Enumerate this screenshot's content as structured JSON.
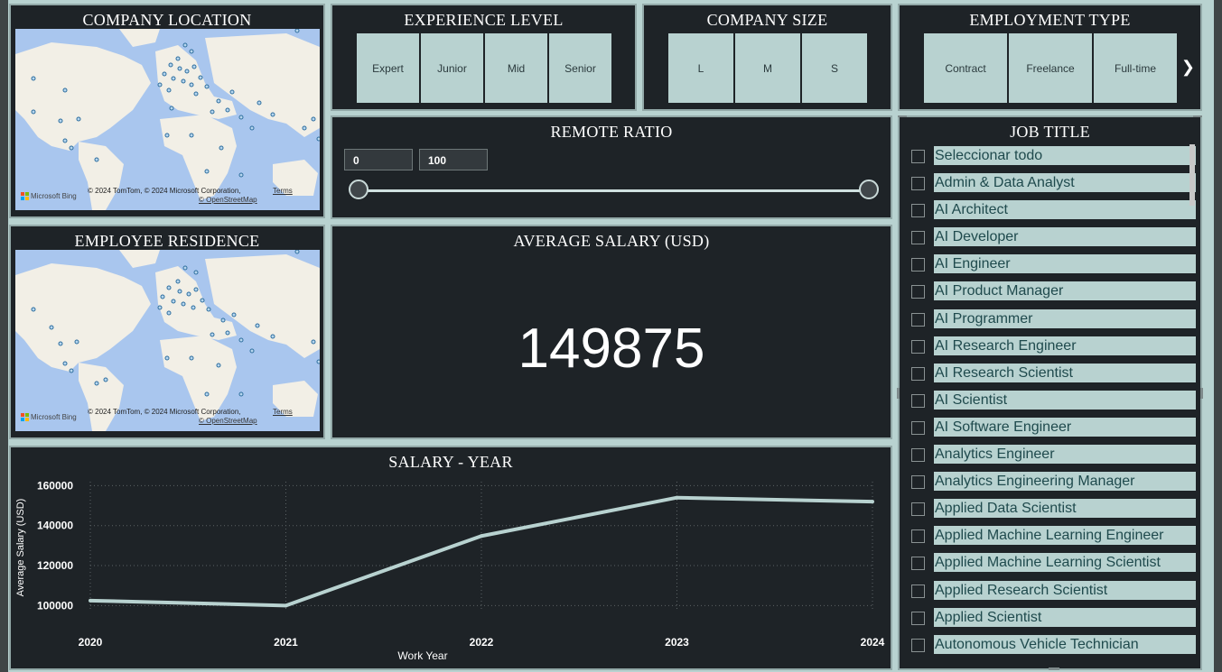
{
  "company_location": {
    "title": "COMPANY LOCATION",
    "attribution": "© 2024 TomTom, © 2024 Microsoft Corporation,",
    "terms": "Terms",
    "osm": "© OpenStreetMap",
    "bing": "Microsoft Bing"
  },
  "employee_residence": {
    "title": "EMPLOYEE RESIDENCE",
    "attribution": "© 2024 TomTom, © 2024 Microsoft Corporation,",
    "terms": "Terms",
    "osm": "© OpenStreetMap",
    "bing": "Microsoft Bing"
  },
  "experience_level": {
    "title": "EXPERIENCE LEVEL",
    "options": [
      "Expert",
      "Junior",
      "Mid",
      "Senior"
    ]
  },
  "company_size": {
    "title": "COMPANY SIZE",
    "options": [
      "L",
      "M",
      "S"
    ]
  },
  "employment_type": {
    "title": "EMPLOYMENT TYPE",
    "options": [
      "Contract",
      "Freelance",
      "Full-time"
    ]
  },
  "remote_ratio": {
    "title": "REMOTE RATIO",
    "min": "0",
    "max": "100"
  },
  "average_salary": {
    "title": "AVERAGE SALARY (USD)",
    "value": "149875"
  },
  "job_title": {
    "title": "JOB TITLE",
    "items": [
      "Seleccionar todo",
      "Admin & Data Analyst",
      "AI Architect",
      "AI Developer",
      "AI Engineer",
      "AI Product Manager",
      "AI Programmer",
      "AI Research Engineer",
      "AI Research Scientist",
      "AI Scientist",
      "AI Software Engineer",
      "Analytics Engineer",
      "Analytics Engineering Manager",
      "Applied Data Scientist",
      "Applied Machine Learning Engineer",
      "Applied Machine Learning Scientist",
      "Applied Research Scientist",
      "Applied Scientist",
      "Autonomous Vehicle Technician"
    ]
  },
  "chart_data": {
    "type": "line",
    "title": "SALARY - YEAR",
    "xlabel": "Work Year",
    "ylabel": "Average Salary (USD)",
    "categories": [
      "2020",
      "2021",
      "2022",
      "2023",
      "2024"
    ],
    "values": [
      102500,
      100000,
      134800,
      154000,
      152000
    ],
    "yticks": [
      100000,
      120000,
      140000,
      160000
    ],
    "ylim": [
      97000,
      162000
    ],
    "grid": true,
    "line_color": "#b8d2d0"
  }
}
